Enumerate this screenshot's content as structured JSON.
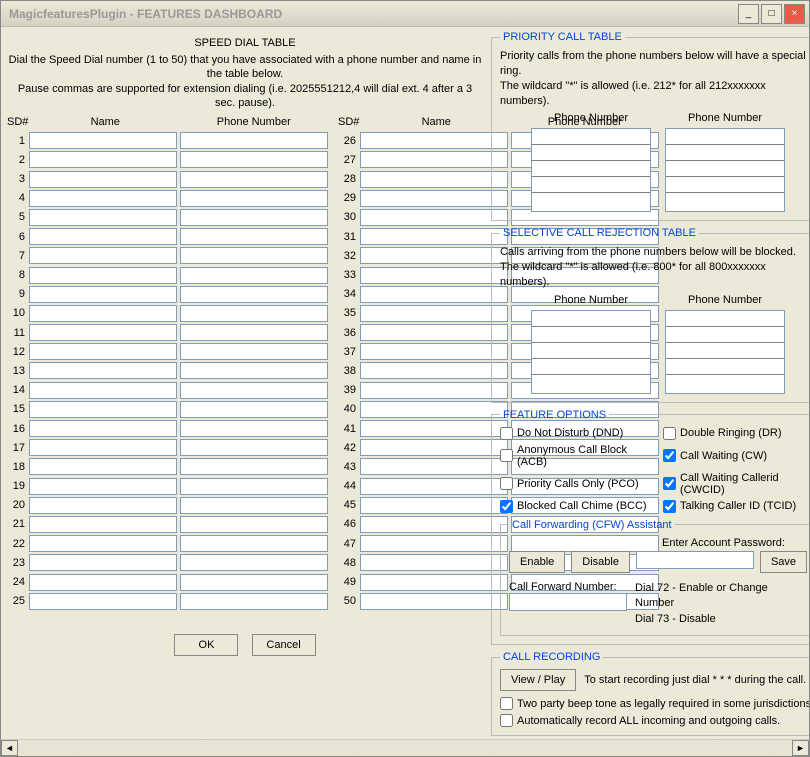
{
  "title": "MagicfeaturesPlugin - FEATURES DASHBOARD",
  "win": {
    "min": "_",
    "max": "□",
    "close": "×"
  },
  "speed_dial": {
    "heading": "SPEED DIAL TABLE",
    "desc1": "Dial the Speed Dial number (1 to 50) that you have associated with a phone number and name in the table below.",
    "desc2": "Pause commas are supported for extension dialing (i.e. 2025551212,4 will dial ext. 4 after a 3 sec. pause).",
    "col_sd": "SD#",
    "col_name": "Name",
    "col_phone": "Phone Number",
    "rows_left": [
      "1",
      "2",
      "3",
      "4",
      "5",
      "6",
      "7",
      "8",
      "9",
      "10",
      "11",
      "12",
      "13",
      "14",
      "15",
      "16",
      "17",
      "18",
      "19",
      "20",
      "21",
      "22",
      "23",
      "24",
      "25"
    ],
    "rows_right": [
      "26",
      "27",
      "28",
      "29",
      "30",
      "31",
      "32",
      "33",
      "34",
      "35",
      "36",
      "37",
      "38",
      "39",
      "40",
      "41",
      "42",
      "43",
      "44",
      "45",
      "46",
      "47",
      "48",
      "49",
      "50"
    ]
  },
  "buttons": {
    "ok": "OK",
    "cancel": "Cancel"
  },
  "priority": {
    "legend": "PRIORITY CALL TABLE",
    "desc1": "Priority calls from the phone numbers below will have a special ring.",
    "desc2": "The wildcard \"*\" is allowed (i.e. 212* for all 212xxxxxxx numbers).",
    "col": "Phone Number"
  },
  "scr": {
    "legend": "SELECTIVE CALL REJECTION TABLE",
    "desc1": "Calls arriving from the phone numbers below will be blocked.",
    "desc2": "The wildcard \"*\" is allowed (i.e. 800* for all 800xxxxxxx numbers).",
    "col": "Phone Number"
  },
  "features": {
    "legend": "FEATURE OPTIONS",
    "dnd": "Do Not Disturb (DND)",
    "dr": "Double Ringing (DR)",
    "acb": "Anonymous Call Block (ACB)",
    "cw": "Call Waiting (CW)",
    "pco": "Priority Calls Only (PCO)",
    "cwcid": "Call Waiting Callerid (CWCID)",
    "bcc": "Blocked Call Chime (BCC)",
    "tcid": "Talking Caller ID (TCID)",
    "cfw_legend": "Call Forwarding (CFW) Assistant",
    "enable": "Enable",
    "disable": "Disable",
    "enter_pw": "Enter Account Password:",
    "save": "Save",
    "cfw_num_label": "Call Forward Number:",
    "dial72": "Dial 72 - Enable or Change Number",
    "dial73": "Dial 73 - Disable"
  },
  "recording": {
    "legend": "CALL RECORDING",
    "view": "View / Play",
    "instr": "To start recording just dial  * * *  during the call.",
    "beep": "Two party beep tone as legally required in some jurisdictions.",
    "auto": "Automatically record ALL incoming and outgoing calls."
  },
  "checked": {
    "dnd": false,
    "dr": false,
    "acb": false,
    "cw": true,
    "pco": false,
    "cwcid": true,
    "bcc": true,
    "tcid": true,
    "beep": false,
    "auto": false
  }
}
